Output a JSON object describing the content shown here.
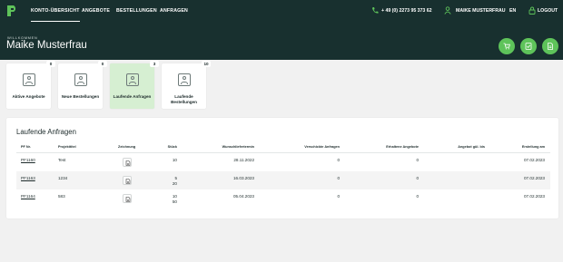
{
  "nav": {
    "items": [
      "KONTO-ÜBERSICHT",
      "ANGEBOTE",
      "BESTELLUNGEN",
      "ANFRAGEN"
    ],
    "active": "KONTO-ÜBERSICHT",
    "phone": "+ 49 (0) 2273 95 373 62",
    "user": "MAIKE MUSTERFRAU",
    "language": "EN",
    "logout": "LOGOUT"
  },
  "header": {
    "welcome": "WILLKOMMEN",
    "name": "Maike Musterfrau",
    "action_icons": [
      "cart-icon",
      "orders-icon",
      "document-icon"
    ]
  },
  "tiles": [
    {
      "label": "Aktive Angebote",
      "count": "0"
    },
    {
      "label": "Neue Bestellungen",
      "count": "0"
    },
    {
      "label": "Laufende Anfragen",
      "count": "3",
      "active": true
    },
    {
      "label": "Laufende Bestellungen",
      "count": "10"
    }
  ],
  "card": {
    "title": "Laufende Anfragen",
    "columns": [
      "PF Nr.",
      "Projekttitel",
      "Zeichnung",
      "Stück",
      "Wunschliefertermin",
      "Verschickte Anfragen",
      "Erhaltene Angebote",
      "Angebot gül. bis",
      "Erstellung am"
    ],
    "rows": [
      {
        "pf": "PF1160",
        "title": "Test",
        "qty": [
          "10"
        ],
        "date": "28.11.2022",
        "sent": "0",
        "received": "0",
        "valid": "",
        "created": "07.02.2023"
      },
      {
        "pf": "PF1163",
        "title": "1234",
        "qty": [
          "5",
          "20"
        ],
        "date": "16.03.2023",
        "sent": "0",
        "received": "0",
        "valid": "",
        "created": "07.02.2023"
      },
      {
        "pf": "PF1164",
        "title": "583",
        "qty": [
          "10",
          "50"
        ],
        "date": "05.04.2023",
        "sent": "0",
        "received": "0",
        "valid": "",
        "created": "07.02.2023"
      }
    ]
  },
  "colors": {
    "dark": "#18302f",
    "accent": "#5ec35a",
    "tile_active": "#d6efd2"
  }
}
